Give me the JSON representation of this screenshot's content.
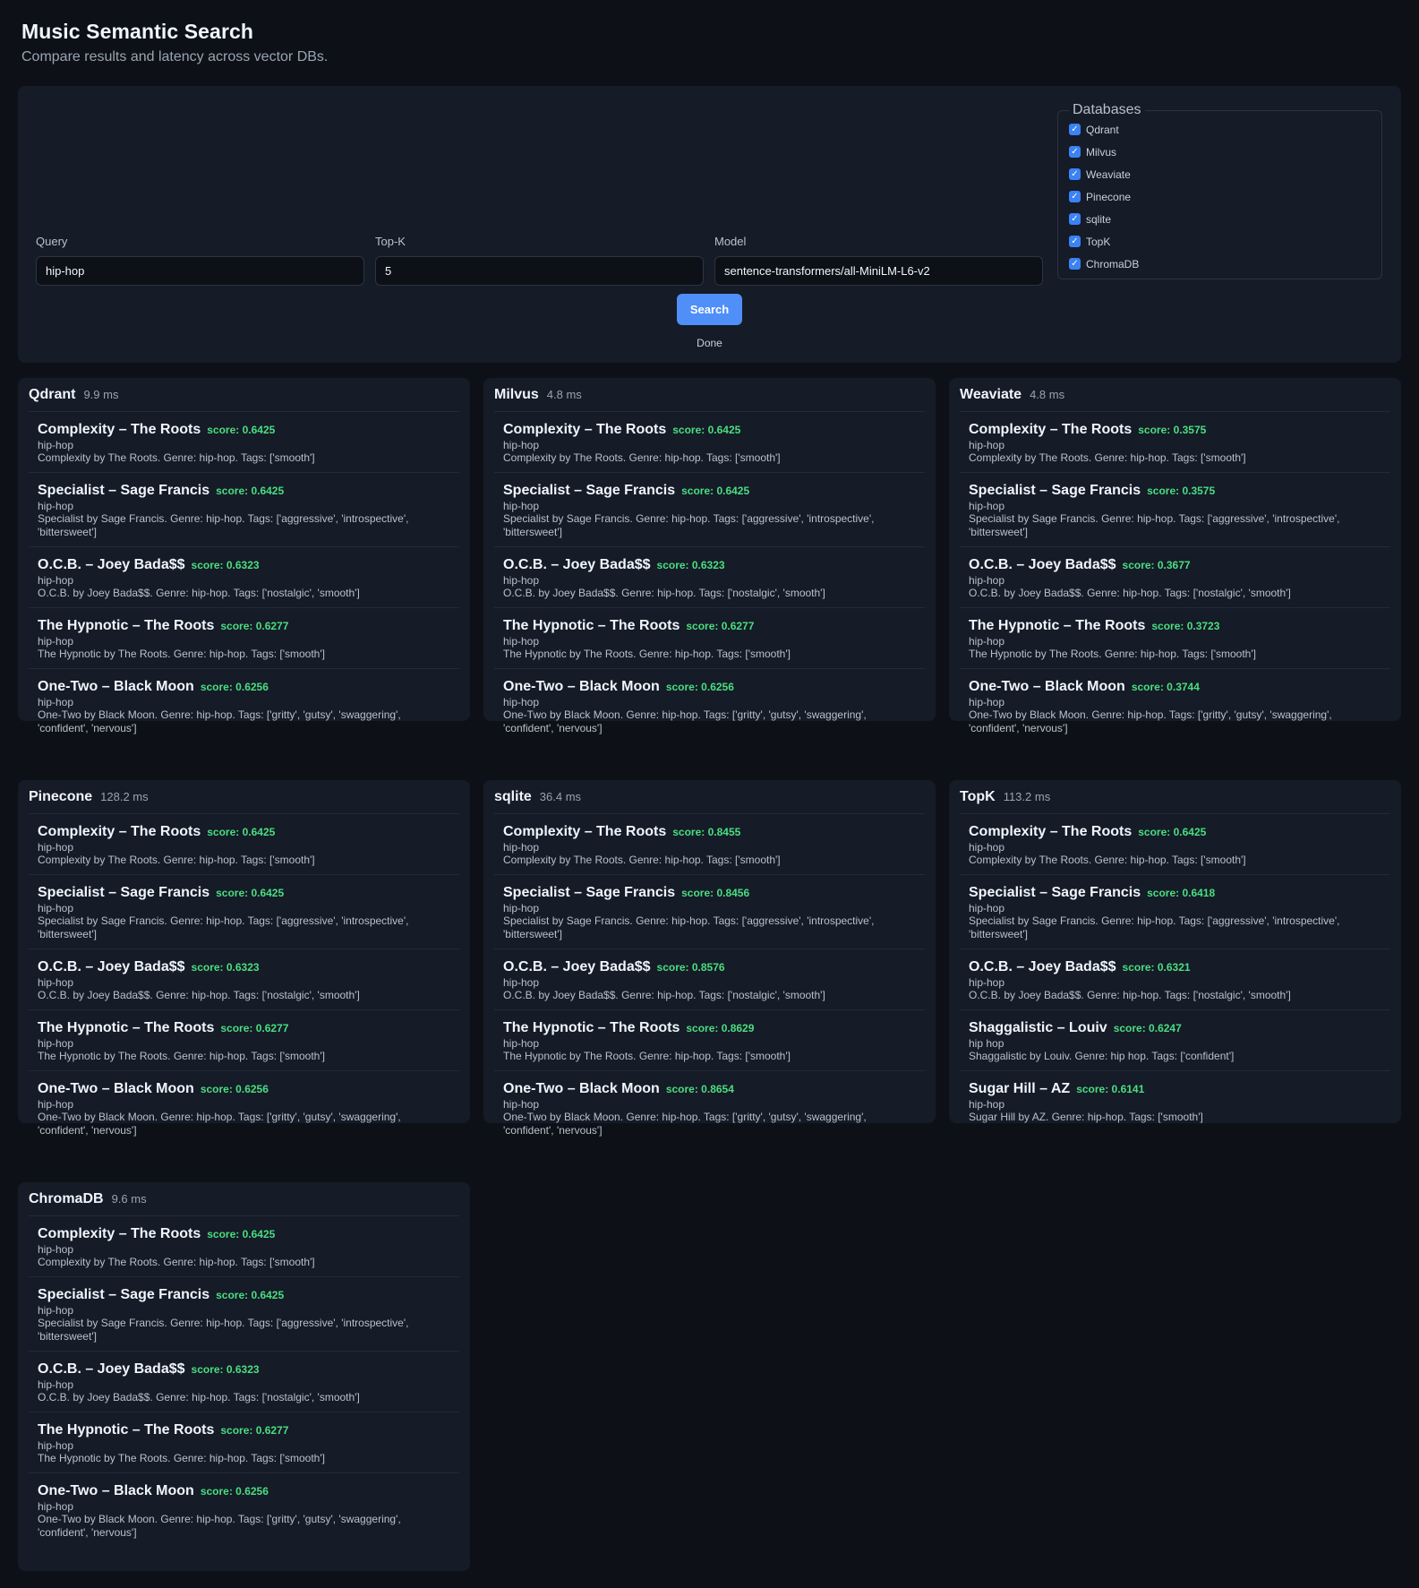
{
  "header": {
    "title": "Music Semantic Search",
    "subtitle": "Compare results and latency across vector DBs."
  },
  "controls": {
    "query": {
      "label": "Query",
      "value": "hip-hop"
    },
    "topk": {
      "label": "Top-K",
      "value": "5"
    },
    "model": {
      "label": "Model",
      "value": "sentence-transformers/all-MiniLM-L6-v2"
    },
    "databases": {
      "legend": "Databases",
      "items": [
        {
          "label": "Qdrant",
          "checked": true
        },
        {
          "label": "Milvus",
          "checked": true
        },
        {
          "label": "Weaviate",
          "checked": true
        },
        {
          "label": "Pinecone",
          "checked": true
        },
        {
          "label": "sqlite",
          "checked": true
        },
        {
          "label": "TopK",
          "checked": true
        },
        {
          "label": "ChromaDB",
          "checked": true
        }
      ]
    },
    "search_label": "Search",
    "status": "Done"
  },
  "results": [
    {
      "name": "Qdrant",
      "latency": "9.9 ms",
      "items": [
        {
          "title": "Complexity – The Roots",
          "score": "score: 0.6425",
          "genre": "hip-hop",
          "desc": "Complexity by The Roots. Genre: hip-hop. Tags: ['smooth']"
        },
        {
          "title": "Specialist – Sage Francis",
          "score": "score: 0.6425",
          "genre": "hip-hop",
          "desc": "Specialist by Sage Francis. Genre: hip-hop. Tags: ['aggressive', 'introspective', 'bittersweet']"
        },
        {
          "title": "O.C.B. – Joey Bada$$",
          "score": "score: 0.6323",
          "genre": "hip-hop",
          "desc": "O.C.B. by Joey Bada$$. Genre: hip-hop. Tags: ['nostalgic', 'smooth']"
        },
        {
          "title": "The Hypnotic – The Roots",
          "score": "score: 0.6277",
          "genre": "hip-hop",
          "desc": "The Hypnotic by The Roots. Genre: hip-hop. Tags: ['smooth']"
        },
        {
          "title": "One-Two – Black Moon",
          "score": "score: 0.6256",
          "genre": "hip-hop",
          "desc": "One-Two by Black Moon. Genre: hip-hop. Tags: ['gritty', 'gutsy', 'swaggering', 'confident', 'nervous']"
        }
      ]
    },
    {
      "name": "Milvus",
      "latency": "4.8 ms",
      "items": [
        {
          "title": "Complexity – The Roots",
          "score": "score: 0.6425",
          "genre": "hip-hop",
          "desc": "Complexity by The Roots. Genre: hip-hop. Tags: ['smooth']"
        },
        {
          "title": "Specialist – Sage Francis",
          "score": "score: 0.6425",
          "genre": "hip-hop",
          "desc": "Specialist by Sage Francis. Genre: hip-hop. Tags: ['aggressive', 'introspective', 'bittersweet']"
        },
        {
          "title": "O.C.B. – Joey Bada$$",
          "score": "score: 0.6323",
          "genre": "hip-hop",
          "desc": "O.C.B. by Joey Bada$$. Genre: hip-hop. Tags: ['nostalgic', 'smooth']"
        },
        {
          "title": "The Hypnotic – The Roots",
          "score": "score: 0.6277",
          "genre": "hip-hop",
          "desc": "The Hypnotic by The Roots. Genre: hip-hop. Tags: ['smooth']"
        },
        {
          "title": "One-Two – Black Moon",
          "score": "score: 0.6256",
          "genre": "hip-hop",
          "desc": "One-Two by Black Moon. Genre: hip-hop. Tags: ['gritty', 'gutsy', 'swaggering', 'confident', 'nervous']"
        }
      ]
    },
    {
      "name": "Weaviate",
      "latency": "4.8 ms",
      "items": [
        {
          "title": "Complexity – The Roots",
          "score": "score: 0.3575",
          "genre": "hip-hop",
          "desc": "Complexity by The Roots. Genre: hip-hop. Tags: ['smooth']"
        },
        {
          "title": "Specialist – Sage Francis",
          "score": "score: 0.3575",
          "genre": "hip-hop",
          "desc": "Specialist by Sage Francis. Genre: hip-hop. Tags: ['aggressive', 'introspective', 'bittersweet']"
        },
        {
          "title": "O.C.B. – Joey Bada$$",
          "score": "score: 0.3677",
          "genre": "hip-hop",
          "desc": "O.C.B. by Joey Bada$$. Genre: hip-hop. Tags: ['nostalgic', 'smooth']"
        },
        {
          "title": "The Hypnotic – The Roots",
          "score": "score: 0.3723",
          "genre": "hip-hop",
          "desc": "The Hypnotic by The Roots. Genre: hip-hop. Tags: ['smooth']"
        },
        {
          "title": "One-Two – Black Moon",
          "score": "score: 0.3744",
          "genre": "hip-hop",
          "desc": "One-Two by Black Moon. Genre: hip-hop. Tags: ['gritty', 'gutsy', 'swaggering', 'confident', 'nervous']"
        }
      ]
    },
    {
      "name": "Pinecone",
      "latency": "128.2 ms",
      "items": [
        {
          "title": "Complexity – The Roots",
          "score": "score: 0.6425",
          "genre": "hip-hop",
          "desc": "Complexity by The Roots. Genre: hip-hop. Tags: ['smooth']"
        },
        {
          "title": "Specialist – Sage Francis",
          "score": "score: 0.6425",
          "genre": "hip-hop",
          "desc": "Specialist by Sage Francis. Genre: hip-hop. Tags: ['aggressive', 'introspective', 'bittersweet']"
        },
        {
          "title": "O.C.B. – Joey Bada$$",
          "score": "score: 0.6323",
          "genre": "hip-hop",
          "desc": "O.C.B. by Joey Bada$$. Genre: hip-hop. Tags: ['nostalgic', 'smooth']"
        },
        {
          "title": "The Hypnotic – The Roots",
          "score": "score: 0.6277",
          "genre": "hip-hop",
          "desc": "The Hypnotic by The Roots. Genre: hip-hop. Tags: ['smooth']"
        },
        {
          "title": "One-Two – Black Moon",
          "score": "score: 0.6256",
          "genre": "hip-hop",
          "desc": "One-Two by Black Moon. Genre: hip-hop. Tags: ['gritty', 'gutsy', 'swaggering', 'confident', 'nervous']"
        }
      ]
    },
    {
      "name": "sqlite",
      "latency": "36.4 ms",
      "items": [
        {
          "title": "Complexity – The Roots",
          "score": "score: 0.8455",
          "genre": "hip-hop",
          "desc": "Complexity by The Roots. Genre: hip-hop. Tags: ['smooth']"
        },
        {
          "title": "Specialist – Sage Francis",
          "score": "score: 0.8456",
          "genre": "hip-hop",
          "desc": "Specialist by Sage Francis. Genre: hip-hop. Tags: ['aggressive', 'introspective', 'bittersweet']"
        },
        {
          "title": "O.C.B. – Joey Bada$$",
          "score": "score: 0.8576",
          "genre": "hip-hop",
          "desc": "O.C.B. by Joey Bada$$. Genre: hip-hop. Tags: ['nostalgic', 'smooth']"
        },
        {
          "title": "The Hypnotic – The Roots",
          "score": "score: 0.8629",
          "genre": "hip-hop",
          "desc": "The Hypnotic by The Roots. Genre: hip-hop. Tags: ['smooth']"
        },
        {
          "title": "One-Two – Black Moon",
          "score": "score: 0.8654",
          "genre": "hip-hop",
          "desc": "One-Two by Black Moon. Genre: hip-hop. Tags: ['gritty', 'gutsy', 'swaggering', 'confident', 'nervous']"
        }
      ]
    },
    {
      "name": "TopK",
      "latency": "113.2 ms",
      "items": [
        {
          "title": "Complexity – The Roots",
          "score": "score: 0.6425",
          "genre": "hip-hop",
          "desc": "Complexity by The Roots. Genre: hip-hop. Tags: ['smooth']"
        },
        {
          "title": "Specialist – Sage Francis",
          "score": "score: 0.6418",
          "genre": "hip-hop",
          "desc": "Specialist by Sage Francis. Genre: hip-hop. Tags: ['aggressive', 'introspective', 'bittersweet']"
        },
        {
          "title": "O.C.B. – Joey Bada$$",
          "score": "score: 0.6321",
          "genre": "hip-hop",
          "desc": "O.C.B. by Joey Bada$$. Genre: hip-hop. Tags: ['nostalgic', 'smooth']"
        },
        {
          "title": "Shaggalistic – Louiv",
          "score": "score: 0.6247",
          "genre": "hip hop",
          "desc": "Shaggalistic by Louiv. Genre: hip hop. Tags: ['confident']"
        },
        {
          "title": "Sugar Hill – AZ",
          "score": "score: 0.6141",
          "genre": "hip-hop",
          "desc": "Sugar Hill by AZ. Genre: hip-hop. Tags: ['smooth']"
        }
      ]
    },
    {
      "name": "ChromaDB",
      "latency": "9.6 ms",
      "items": [
        {
          "title": "Complexity – The Roots",
          "score": "score: 0.6425",
          "genre": "hip-hop",
          "desc": "Complexity by The Roots. Genre: hip-hop. Tags: ['smooth']"
        },
        {
          "title": "Specialist – Sage Francis",
          "score": "score: 0.6425",
          "genre": "hip-hop",
          "desc": "Specialist by Sage Francis. Genre: hip-hop. Tags: ['aggressive', 'introspective', 'bittersweet']"
        },
        {
          "title": "O.C.B. – Joey Bada$$",
          "score": "score: 0.6323",
          "genre": "hip-hop",
          "desc": "O.C.B. by Joey Bada$$. Genre: hip-hop. Tags: ['nostalgic', 'smooth']"
        },
        {
          "title": "The Hypnotic – The Roots",
          "score": "score: 0.6277",
          "genre": "hip-hop",
          "desc": "The Hypnotic by The Roots. Genre: hip-hop. Tags: ['smooth']"
        },
        {
          "title": "One-Two – Black Moon",
          "score": "score: 0.6256",
          "genre": "hip-hop",
          "desc": "One-Two by Black Moon. Genre: hip-hop. Tags: ['gritty', 'gutsy', 'swaggering', 'confident', 'nervous']"
        }
      ]
    }
  ]
}
